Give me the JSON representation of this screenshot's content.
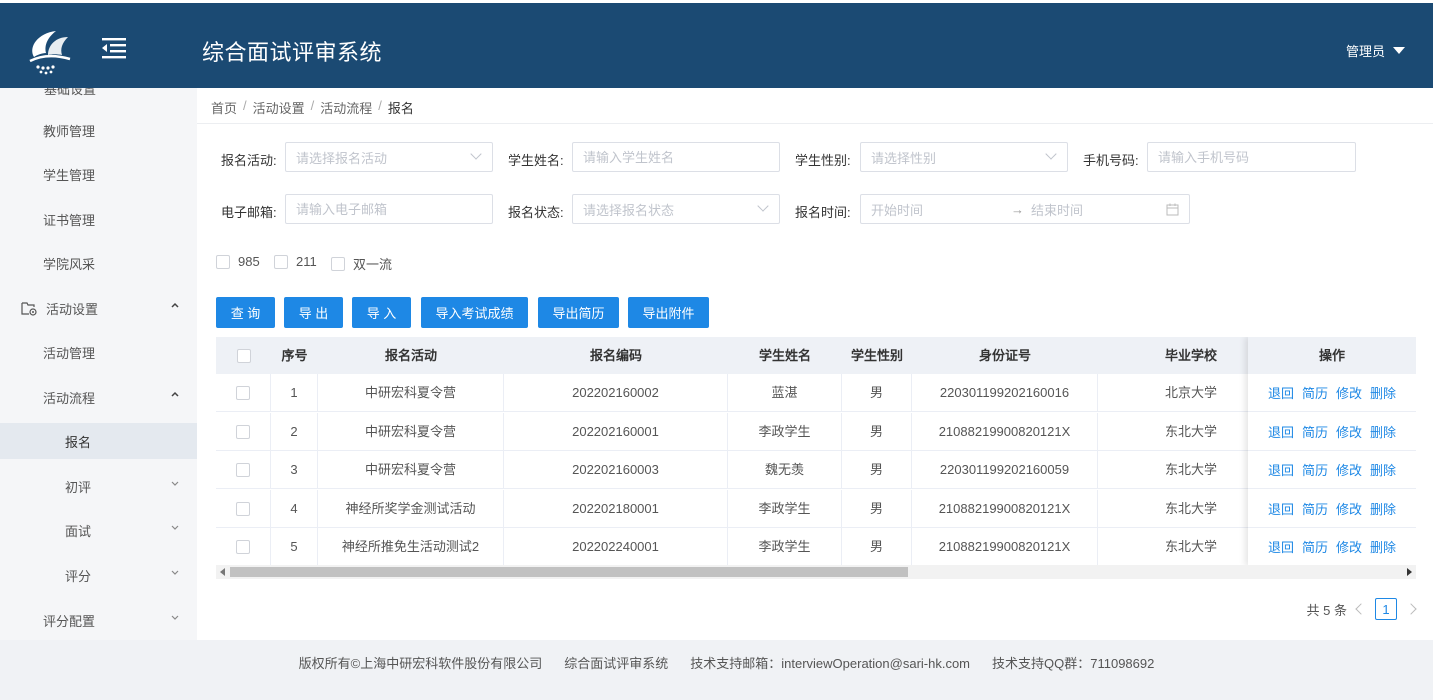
{
  "header": {
    "title": "综合面试评审系统",
    "user": "管理员"
  },
  "sidebar": {
    "items": [
      {
        "label": "基础设置"
      },
      {
        "label": "教师管理"
      },
      {
        "label": "学生管理"
      },
      {
        "label": "证书管理"
      },
      {
        "label": "学院风采"
      },
      {
        "label": "活动设置"
      },
      {
        "label": "活动管理"
      },
      {
        "label": "活动流程"
      },
      {
        "label": "报名"
      },
      {
        "label": "初评"
      },
      {
        "label": "面试"
      },
      {
        "label": "评分"
      },
      {
        "label": "评分配置"
      }
    ]
  },
  "breadcrumb": {
    "home": "首页",
    "level1": "活动设置",
    "level2": "活动流程",
    "current": "报名",
    "sep": "/"
  },
  "filters": {
    "activity": {
      "label": "报名活动:",
      "placeholder": "请选择报名活动"
    },
    "student_name": {
      "label": "学生姓名:",
      "placeholder": "请输入学生姓名"
    },
    "gender": {
      "label": "学生性别:",
      "placeholder": "请选择性别"
    },
    "phone": {
      "label": "手机号码:",
      "placeholder": "请输入手机号码"
    },
    "email": {
      "label": "电子邮箱:",
      "placeholder": "请输入电子邮箱"
    },
    "status": {
      "label": "报名状态:",
      "placeholder": "请选择报名状态"
    },
    "time": {
      "label": "报名时间:",
      "start_placeholder": "开始时间",
      "arrow": "→",
      "end_placeholder": "结束时间"
    },
    "checkboxes": [
      "985",
      "211",
      "双一流"
    ]
  },
  "buttons": {
    "query": "查 询",
    "export": "导 出",
    "import": "导 入",
    "import_scores": "导入考试成绩",
    "export_resume": "导出简历",
    "export_attachments": "导出附件"
  },
  "table": {
    "headers": {
      "index": "序号",
      "activity": "报名活动",
      "code": "报名编码",
      "name": "学生姓名",
      "gender": "学生性别",
      "id_card": "身份证号",
      "school": "毕业学校",
      "ops": "操作"
    },
    "rows": [
      {
        "index": "1",
        "activity": "中研宏科夏令营",
        "code": "202202160002",
        "name": "蓝湛",
        "gender": "男",
        "id_card": "220301199202160016",
        "school": "北京大学"
      },
      {
        "index": "2",
        "activity": "中研宏科夏令营",
        "code": "202202160001",
        "name": "李政学生",
        "gender": "男",
        "id_card": "21088219900820121X",
        "school": "东北大学"
      },
      {
        "index": "3",
        "activity": "中研宏科夏令营",
        "code": "202202160003",
        "name": "魏无羡",
        "gender": "男",
        "id_card": "220301199202160059",
        "school": "东北大学"
      },
      {
        "index": "4",
        "activity": "神经所奖学金测试活动",
        "code": "202202180001",
        "name": "李政学生",
        "gender": "男",
        "id_card": "21088219900820121X",
        "school": "东北大学"
      },
      {
        "index": "5",
        "activity": "神经所推免生活动测试2",
        "code": "202202240001",
        "name": "李政学生",
        "gender": "男",
        "id_card": "21088219900820121X",
        "school": "东北大学"
      }
    ],
    "actions": {
      "back": "退回",
      "resume": "简历",
      "edit": "修改",
      "delete": "删除"
    }
  },
  "pagination": {
    "total": "共 5 条",
    "current_page": "1"
  },
  "footer": {
    "copyright": "版权所有©上海中研宏科软件股份有限公司",
    "system": "综合面试评审系统",
    "email": "技术支持邮箱：interviewOperation@sari-hk.com",
    "qq": "技术支持QQ群：711098692"
  },
  "colors": {
    "header_bg": "#1b4a73",
    "primary": "#1e88e5",
    "active_item": "#e4e9ef"
  }
}
